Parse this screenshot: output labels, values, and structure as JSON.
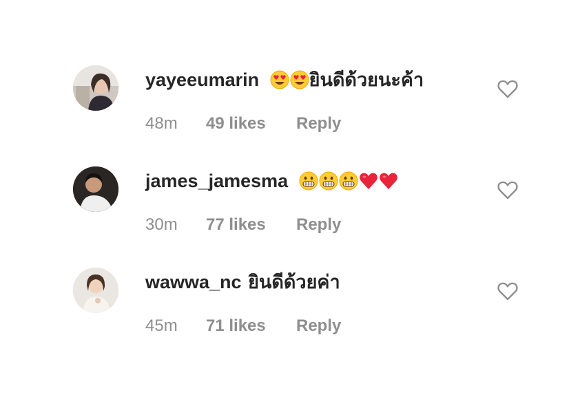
{
  "comments": [
    {
      "username": "yayeeumarin",
      "text": "ยินดีด้วยนะค้า",
      "emojis": [
        "heart-eyes-emoji",
        "heart-eyes-emoji"
      ],
      "time": "48m",
      "likes": "49 likes",
      "reply": "Reply"
    },
    {
      "username": "james_jamesma",
      "text": "",
      "emojis": [
        "grimacing-emoji",
        "grimacing-emoji",
        "grimacing-emoji",
        "red-heart-emoji",
        "red-heart-emoji"
      ],
      "time": "30m",
      "likes": "77 likes",
      "reply": "Reply"
    },
    {
      "username": "wawwa_nc",
      "text": "ยินดีด้วยค่า",
      "emojis": [],
      "time": "45m",
      "likes": "71 likes",
      "reply": "Reply"
    }
  ],
  "colors": {
    "primary_text": "#262626",
    "secondary_text": "#8e8e8e",
    "icon_stroke": "#8e8e8e"
  }
}
